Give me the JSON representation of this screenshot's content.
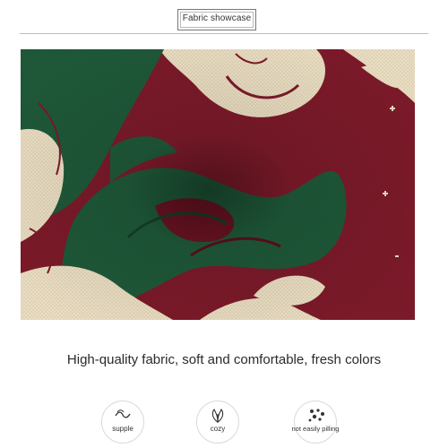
{
  "header": {
    "title": "Fabric showcase"
  },
  "photo": {
    "subject": "knit-fabric-close-up",
    "colors": {
      "red": "#7e1a2a",
      "green": "#1f5a3a",
      "cream": "#ecdfc3"
    }
  },
  "tagline": "High-quality fabric, soft and comfortable, fresh colors",
  "features": [
    {
      "label": "supple",
      "icon": "wave-icon"
    },
    {
      "label": "cozy",
      "icon": "leaf-icon"
    },
    {
      "label": "not easily pilling",
      "icon": "dots-icon"
    }
  ]
}
